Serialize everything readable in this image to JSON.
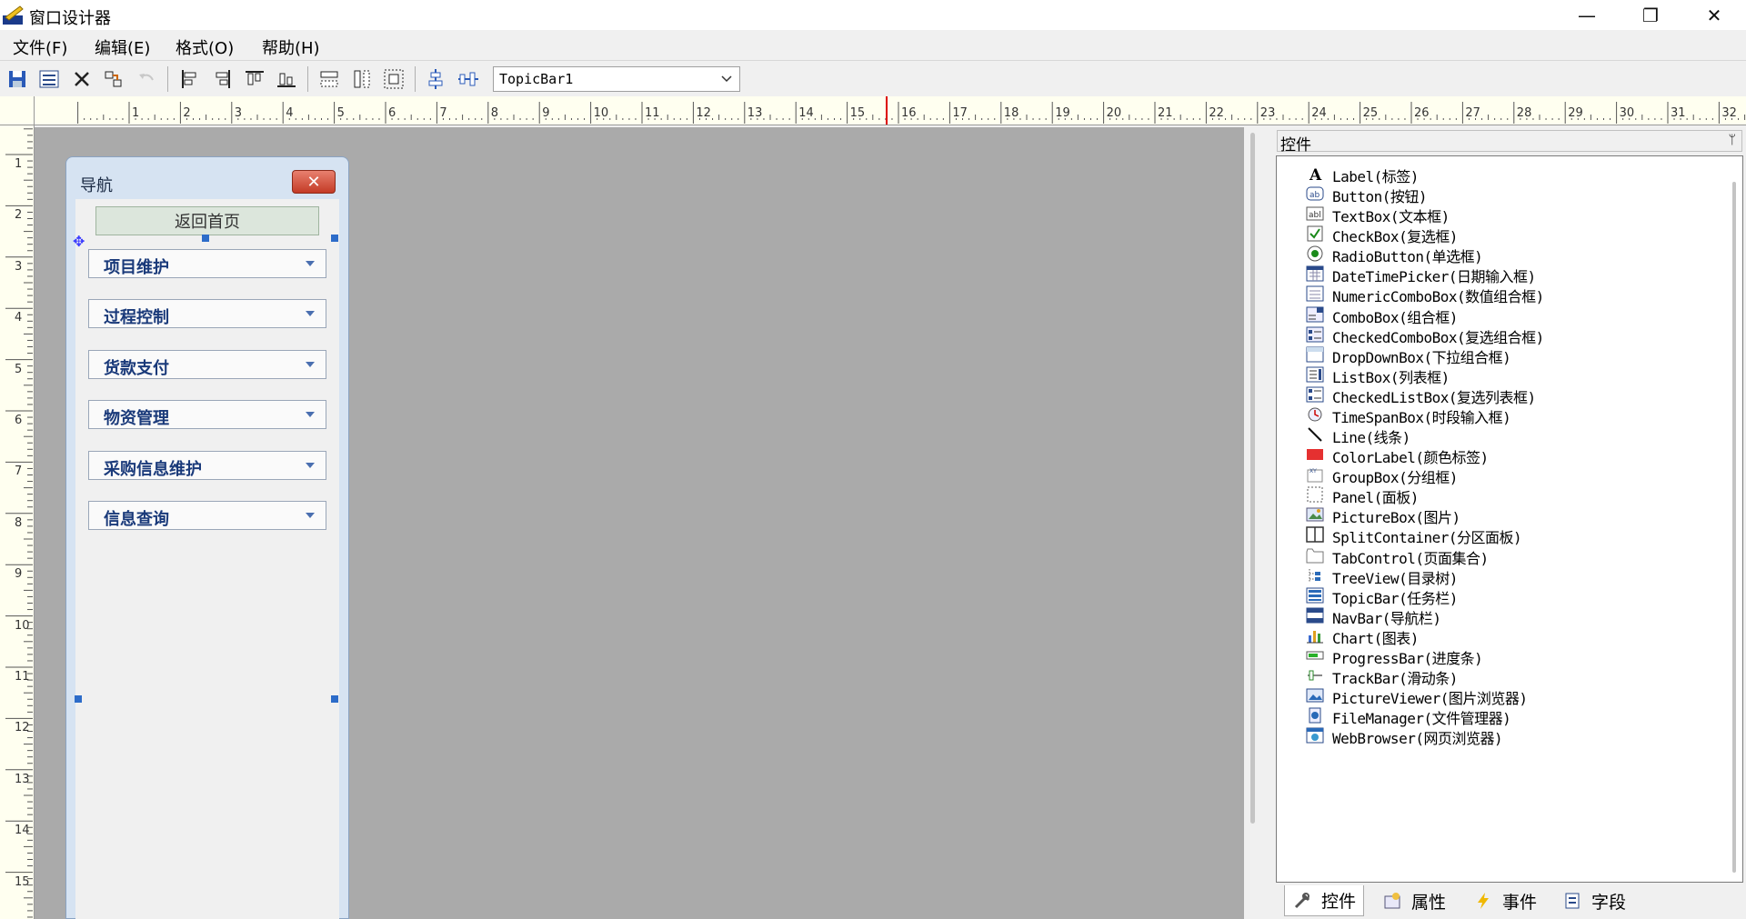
{
  "window": {
    "title": "窗口设计器",
    "minimize": "—",
    "maximize": "❐",
    "close": "✕"
  },
  "menu": [
    "文件(F)",
    "编辑(E)",
    "格式(O)",
    "帮助(H)"
  ],
  "toolbar": {
    "combo_value": "TopicBar1"
  },
  "ruler": {
    "h_labels": [
      "1",
      "2",
      "3",
      "4",
      "5",
      "6",
      "7",
      "8",
      "9",
      "10",
      "11",
      "12",
      "13",
      "14",
      "15",
      "16",
      "17",
      "18",
      "19",
      "20",
      "21",
      "22",
      "23",
      "24",
      "25",
      "26",
      "27",
      "28",
      "29",
      "30",
      "31",
      "32"
    ],
    "v_labels": [
      "1",
      "2",
      "3",
      "4",
      "5",
      "6",
      "7",
      "8",
      "9",
      "10",
      "11",
      "12",
      "13",
      "14",
      "15"
    ]
  },
  "designer": {
    "window_title": "导航",
    "close_glyph": "✕",
    "move_glyph": "✥",
    "home_button": "返回首页",
    "nav_items": [
      "项目维护",
      "过程控制",
      "货款支付",
      "物资管理",
      "采购信息维护",
      "信息查询"
    ]
  },
  "panel": {
    "title": "控件",
    "pin": "ᛘ",
    "controls": [
      {
        "label": "Label(标签)",
        "icon": "label-icon"
      },
      {
        "label": "Button(按钮)",
        "icon": "button-icon"
      },
      {
        "label": "TextBox(文本框)",
        "icon": "textbox-icon"
      },
      {
        "label": "CheckBox(复选框)",
        "icon": "checkbox-icon"
      },
      {
        "label": "RadioButton(单选框)",
        "icon": "radio-icon"
      },
      {
        "label": "DateTimePicker(日期输入框)",
        "icon": "datetime-icon"
      },
      {
        "label": "NumericComboBox(数值组合框)",
        "icon": "numeric-icon"
      },
      {
        "label": "ComboBox(组合框)",
        "icon": "combobox-icon"
      },
      {
        "label": "CheckedComboBox(复选组合框)",
        "icon": "checkedcombo-icon"
      },
      {
        "label": "DropDownBox(下拉组合框)",
        "icon": "dropdown-icon"
      },
      {
        "label": "ListBox(列表框)",
        "icon": "listbox-icon"
      },
      {
        "label": "CheckedListBox(复选列表框)",
        "icon": "checkedlist-icon"
      },
      {
        "label": "TimeSpanBox(时段输入框)",
        "icon": "timespan-icon"
      },
      {
        "label": "Line(线条)",
        "icon": "line-icon"
      },
      {
        "label": "ColorLabel(颜色标签)",
        "icon": "colorlabel-icon"
      },
      {
        "label": "GroupBox(分组框)",
        "icon": "groupbox-icon"
      },
      {
        "label": "Panel(面板)",
        "icon": "panel-icon"
      },
      {
        "label": "PictureBox(图片)",
        "icon": "picture-icon"
      },
      {
        "label": "SplitContainer(分区面板)",
        "icon": "split-icon"
      },
      {
        "label": "TabControl(页面集合)",
        "icon": "tab-icon"
      },
      {
        "label": "TreeView(目录树)",
        "icon": "tree-icon"
      },
      {
        "label": "TopicBar(任务栏)",
        "icon": "topicbar-icon"
      },
      {
        "label": "NavBar(导航栏)",
        "icon": "navbar-icon"
      },
      {
        "label": "Chart(图表)",
        "icon": "chart-icon"
      },
      {
        "label": "ProgressBar(进度条)",
        "icon": "progress-icon"
      },
      {
        "label": "TrackBar(滑动条)",
        "icon": "trackbar-icon"
      },
      {
        "label": "PictureViewer(图片浏览器)",
        "icon": "pictureviewer-icon"
      },
      {
        "label": "FileManager(文件管理器)",
        "icon": "filemanager-icon"
      },
      {
        "label": "WebBrowser(网页浏览器)",
        "icon": "webbrowser-icon"
      }
    ],
    "tabs": [
      "控件",
      "属性",
      "事件",
      "字段"
    ]
  }
}
